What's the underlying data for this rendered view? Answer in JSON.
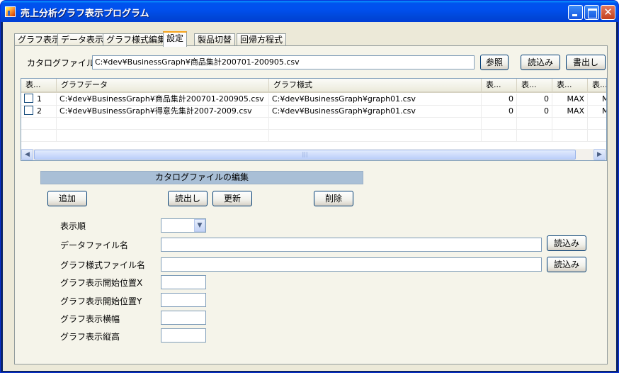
{
  "window": {
    "title": "売上分析グラフ表示プログラム",
    "minimize": "",
    "maximize": "",
    "close": "✕"
  },
  "tabs": [
    "グラフ表示",
    "データ表示",
    "グラフ様式編集",
    "設定",
    "製品切替",
    "回帰方程式"
  ],
  "catalog": {
    "label": "カタログファイル名",
    "path": "C:¥dev¥BusinessGraph¥商品集計200701-200905.csv",
    "browse": "参照",
    "load": "読込み",
    "save": "書出し"
  },
  "grid": {
    "columns": [
      "表...",
      "グラフデータ",
      "グラフ様式",
      "表...",
      "表...",
      "表...",
      "表..."
    ],
    "rows": [
      {
        "no": "1",
        "data": "C:¥dev¥BusinessGraph¥商品集計200701-200905.csv",
        "style": "C:¥dev¥BusinessGraph¥graph01.csv",
        "c4": "0",
        "c5": "0",
        "c6": "MAX",
        "c7": "M"
      },
      {
        "no": "2",
        "data": "C:¥dev¥BusinessGraph¥得意先集計2007-2009.csv",
        "style": "C:¥dev¥BusinessGraph¥graph01.csv",
        "c4": "0",
        "c5": "0",
        "c6": "MAX",
        "c7": "M"
      }
    ],
    "scroll_left": "◀",
    "scroll_right": "▶",
    "thumb_grip": "|||"
  },
  "editor": {
    "section_title": "カタログファイルの編集",
    "add": "追加",
    "read": "読出し",
    "update": "更新",
    "delete": "削除",
    "fields": {
      "order": "表示順",
      "data_file": "データファイル名",
      "style_file": "グラフ様式ファイル名",
      "start_x": "グラフ表示開始位置X",
      "start_y": "グラフ表示開始位置Y",
      "width": "グラフ表示横幅",
      "height": "グラフ表示縦高"
    },
    "load_data": "読込み",
    "load_style": "読込み",
    "combo_arrow": "▼"
  }
}
